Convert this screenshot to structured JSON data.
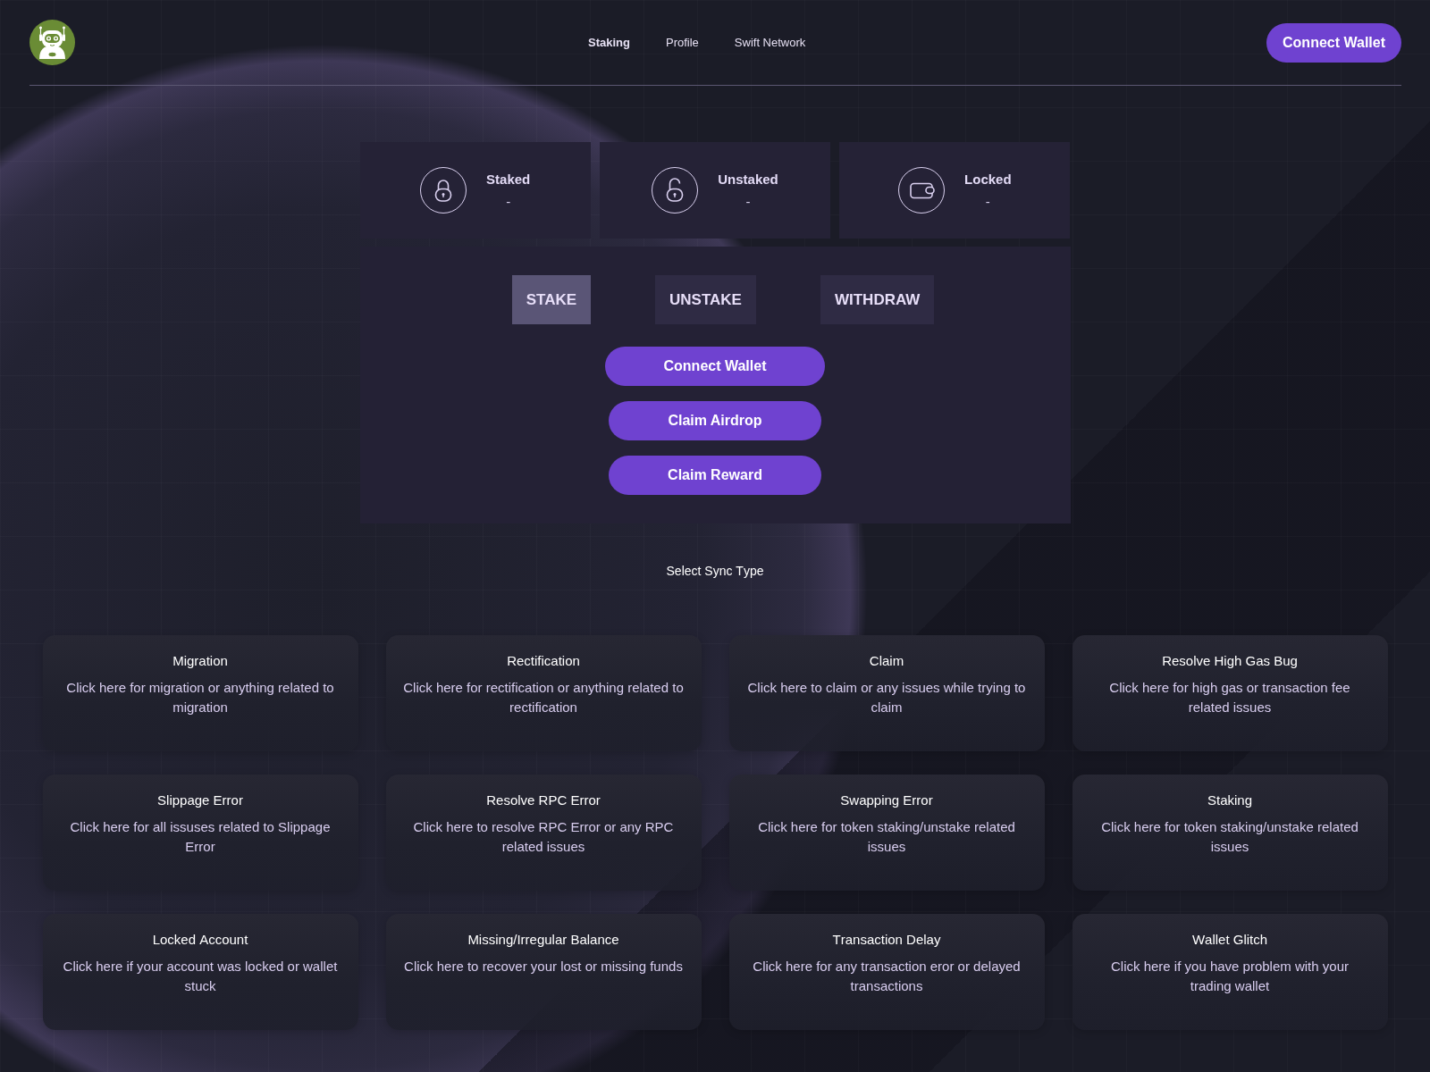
{
  "header": {
    "nav": [
      {
        "label": "Staking",
        "selected": true
      },
      {
        "label": "Profile",
        "selected": false
      },
      {
        "label": "Swift Network",
        "selected": false
      }
    ],
    "connect_button": "Connect Wallet"
  },
  "stats": [
    {
      "kind": "locked",
      "label": "Staked",
      "value": "-"
    },
    {
      "kind": "unlocked",
      "label": "Unstaked",
      "value": "-"
    },
    {
      "kind": "wallet",
      "label": "Locked",
      "value": "-"
    }
  ],
  "action_panel": {
    "tabs": [
      {
        "label": "STAKE",
        "selected": true
      },
      {
        "label": "UNSTAKE",
        "selected": false
      },
      {
        "label": "WITHDRAW",
        "selected": false
      }
    ],
    "buttons": [
      "Connect Wallet",
      "Claim Airdrop",
      "Claim Reward"
    ]
  },
  "sync_section": {
    "heading": "Select Sync Type",
    "options": [
      {
        "title": "Migration",
        "description": "Click here for migration or anything related to migration"
      },
      {
        "title": "Rectification",
        "description": "Click here for rectification or anything related to rectification"
      },
      {
        "title": "Claim",
        "description": "Click here to claim or any issues while trying to claim"
      },
      {
        "title": "Resolve High Gas Bug",
        "description": "Click here for high gas or transaction fee related issues"
      },
      {
        "title": "Slippage Error",
        "description": "Click here for all issuses related to Slippage Error"
      },
      {
        "title": "Resolve RPC Error",
        "description": "Click here to resolve RPC Error or any RPC related issues"
      },
      {
        "title": "Swapping Error",
        "description": "Click here for token staking/unstake related issues"
      },
      {
        "title": "Staking",
        "description": "Click here for token staking/unstake related issues"
      },
      {
        "title": "Locked Account",
        "description": "Click here if your account was locked or wallet stuck"
      },
      {
        "title": "Missing/Irregular Balance",
        "description": "Click here to recover your lost or missing funds"
      },
      {
        "title": "Transaction Delay",
        "description": "Click here for any transaction eror or delayed transactions"
      },
      {
        "title": "Wallet Glitch",
        "description": "Click here if you have problem with your trading wallet"
      }
    ]
  }
}
